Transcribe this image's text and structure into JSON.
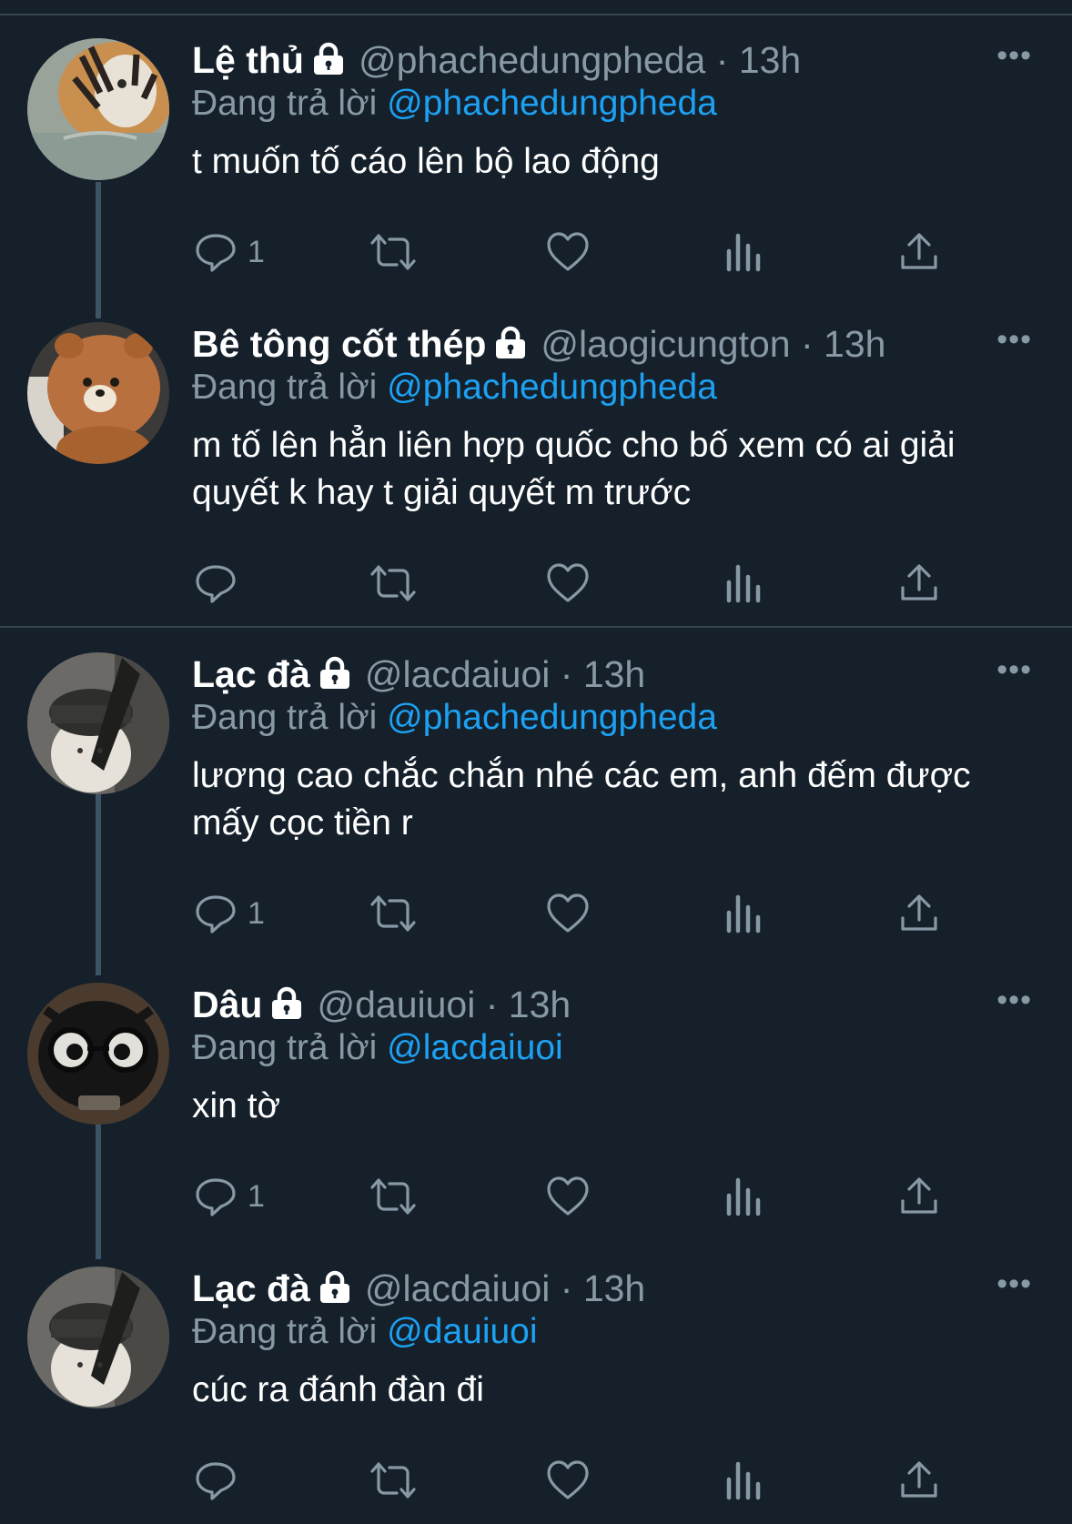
{
  "colors": {
    "background": "#15202b",
    "text": "#ffffff",
    "secondary": "#8899a6",
    "mention": "#1da1f2",
    "divider": "#38444d",
    "thread_line": "#3d5466"
  },
  "icons": [
    "lock-icon",
    "more-icon",
    "reply-icon",
    "retweet-icon",
    "like-icon",
    "analytics-icon",
    "share-icon"
  ],
  "reply_prefix": "Đang trả lời",
  "tweets": [
    {
      "name": "Lệ thủ",
      "handle": "@phachedungpheda",
      "dot": "·",
      "time": "13h",
      "replying_to": "@phachedungpheda",
      "text": "t muốn tố cáo lên bộ lao động",
      "reply_count": "1",
      "more": "•••",
      "avatar": "tiger"
    },
    {
      "name": "Bê tông cốt thép",
      "handle": "@laogicungton",
      "dot": "·",
      "time": "13h",
      "replying_to": "@phachedungpheda",
      "text": "m tố lên hẳn liên hợp quốc cho bố xem có ai giải quyết k hay t giải quyết m trước",
      "reply_count": "",
      "more": "•••",
      "avatar": "bear"
    },
    {
      "name": "Lạc đà",
      "handle": "@lacdaiuoi",
      "dot": "·",
      "time": "13h",
      "replying_to": "@phachedungpheda",
      "text": "lương cao chắc chắn nhé các em, anh đếm được mấy cọc tiền r",
      "reply_count": "1",
      "more": "•••",
      "avatar": "alpaca"
    },
    {
      "name": "Dâu",
      "handle": "@dauiuoi",
      "dot": "·",
      "time": "13h",
      "replying_to": "@lacdaiuoi",
      "text": "xin tờ",
      "reply_count": "1",
      "more": "•••",
      "avatar": "plush"
    },
    {
      "name": "Lạc đà",
      "handle": "@lacdaiuoi",
      "dot": "·",
      "time": "13h",
      "replying_to": "@dauiuoi",
      "text": "cúc ra đánh đàn đi",
      "reply_count": "",
      "more": "•••",
      "avatar": "alpaca"
    }
  ]
}
